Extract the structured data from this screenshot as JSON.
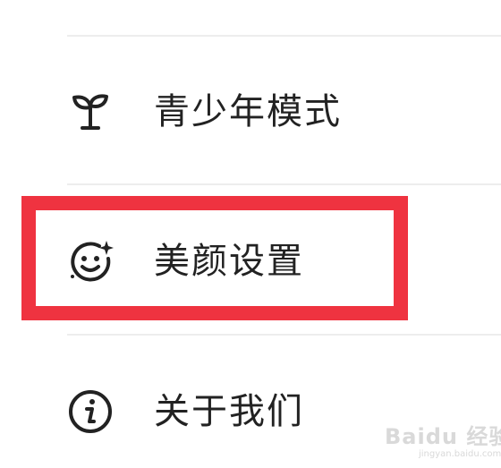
{
  "menu": {
    "items": [
      {
        "label": "青少年模式",
        "icon": "sprout-icon"
      },
      {
        "label": "美颜设置",
        "icon": "smiley-sparkle-icon"
      },
      {
        "label": "关于我们",
        "icon": "info-circle-icon"
      }
    ]
  },
  "highlight": {
    "color": "#ef3340"
  },
  "watermark": {
    "brand": "Baidu 经验",
    "url": "jingyan.baidu.com"
  }
}
